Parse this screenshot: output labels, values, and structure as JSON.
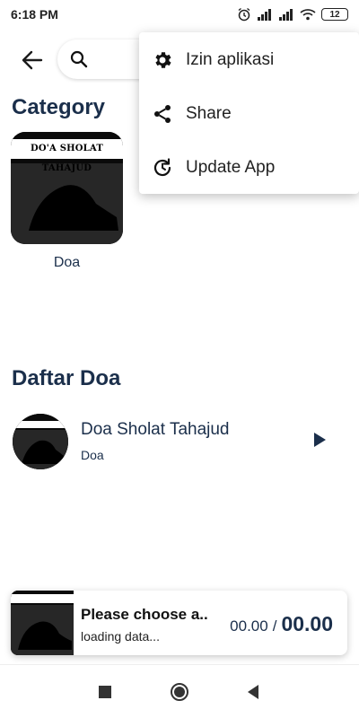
{
  "status_bar": {
    "time": "6:18 PM",
    "battery": "12"
  },
  "top_bar": {
    "search_placeholder": ""
  },
  "category_section": {
    "title": "Category",
    "items": [
      {
        "label": "Doa",
        "thumb_text": "DO'A SHOLAT TAHAJUD"
      }
    ]
  },
  "list_section": {
    "title": "Daftar Doa",
    "items": [
      {
        "title": "Doa Sholat Tahajud",
        "subtitle": "Doa"
      }
    ]
  },
  "player": {
    "title": "Please choose a..",
    "subtitle": "loading data...",
    "current_time": "00.00",
    "separator": "/",
    "duration": "00.00"
  },
  "menu": {
    "items": [
      {
        "label": "Izin aplikasi",
        "icon": "gear-icon"
      },
      {
        "label": "Share",
        "icon": "share-icon"
      },
      {
        "label": "Update App",
        "icon": "update-icon"
      }
    ]
  },
  "colors": {
    "primary_text": "#1b2f4b",
    "background": "#ffffff"
  }
}
